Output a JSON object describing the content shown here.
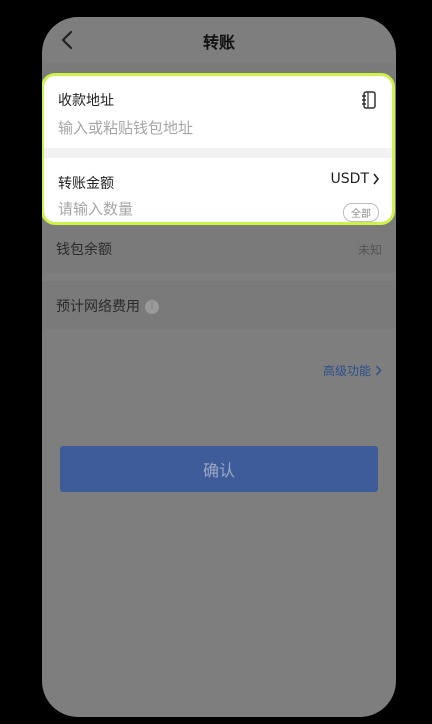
{
  "header": {
    "title": "转账"
  },
  "recipient": {
    "label": "收款地址",
    "placeholder": "输入或粘贴钱包地址"
  },
  "amount": {
    "label": "转账金额",
    "placeholder": "请输入数量",
    "token": "USDT",
    "all_button": "全部"
  },
  "balance": {
    "label": "钱包余额",
    "value": "未知"
  },
  "fee": {
    "label": "预计网络费用"
  },
  "advanced": {
    "label": "高级功能"
  },
  "confirm": {
    "label": "确认"
  },
  "colors": {
    "highlight": "#cdf24a",
    "button": "#3f5c9a",
    "link": "#2c4f8c"
  }
}
